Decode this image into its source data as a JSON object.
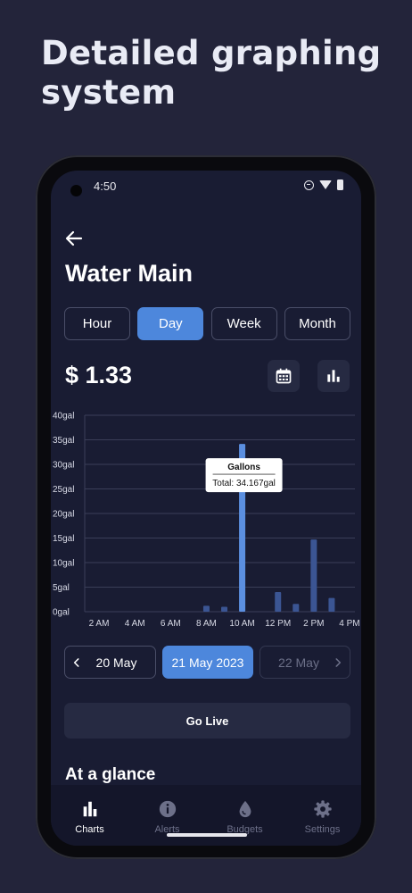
{
  "promo": {
    "headline": "Detailed graphing system"
  },
  "status_bar": {
    "time": "4:50"
  },
  "header": {
    "title": "Water Main"
  },
  "tabs": [
    {
      "label": "Hour",
      "active": false
    },
    {
      "label": "Day",
      "active": true
    },
    {
      "label": "Week",
      "active": false
    },
    {
      "label": "Month",
      "active": false
    }
  ],
  "summary": {
    "cost": "$ 1.33"
  },
  "icons": {
    "back": "arrow-left-icon",
    "calendar": "calendar-icon",
    "chart_toggle": "bar-chart-icon"
  },
  "chart_data": {
    "type": "bar",
    "x": [
      1.5,
      2,
      2.5,
      3,
      3.5,
      4,
      4.5,
      5,
      5.5,
      6,
      6.5,
      7,
      7.5,
      8,
      8.5,
      9,
      9.5,
      10,
      10.5,
      11,
      11.5,
      12,
      12.5,
      13,
      13.5,
      14,
      14.5,
      15,
      15.5,
      16
    ],
    "values": [
      0,
      0,
      0,
      0,
      0,
      0,
      0,
      0,
      0,
      0,
      0,
      0,
      0,
      1.2,
      0,
      1,
      0,
      34.167,
      0,
      0,
      0,
      4,
      0,
      1.6,
      0,
      14.7,
      0,
      2.8,
      0,
      0
    ],
    "x_ticks": [
      2,
      4,
      6,
      8,
      10,
      12,
      14,
      16
    ],
    "x_tick_labels": [
      "2 AM",
      "4 AM",
      "6 AM",
      "8 AM",
      "10 AM",
      "12 PM",
      "2 PM",
      "4 PM"
    ],
    "y_ticks": [
      0,
      5,
      10,
      15,
      20,
      25,
      30,
      35,
      40
    ],
    "y_tick_labels": [
      "0gal",
      "5gal",
      "10gal",
      "15gal",
      "20gal",
      "25gal",
      "30gal",
      "35gal",
      "40gal"
    ],
    "xlim": [
      1.2,
      16.3
    ],
    "ylim": [
      0,
      40
    ],
    "grid": true,
    "bar_color": "#3b5593",
    "highlight_color": "#5b8fe0",
    "highlight_index": 17,
    "tooltip": {
      "title": "Gallons",
      "text": "Total: 34.167gal"
    }
  },
  "date_nav": {
    "prev": "20 May",
    "current": "21 May 2023",
    "next": "22 May"
  },
  "go_live": {
    "label": "Go Live"
  },
  "at_a_glance": {
    "title": "At a glance"
  },
  "bottom_nav": [
    {
      "label": "Charts",
      "icon": "bar-chart-icon",
      "active": true
    },
    {
      "label": "Alerts",
      "icon": "info-icon",
      "active": false
    },
    {
      "label": "Budgets",
      "icon": "water-drop-icon",
      "active": false
    },
    {
      "label": "Settings",
      "icon": "gear-icon",
      "active": false
    }
  ],
  "colors": {
    "background": "#23243a",
    "screen": "#191c33",
    "accent": "#4d87dc",
    "card": "#262a42"
  }
}
